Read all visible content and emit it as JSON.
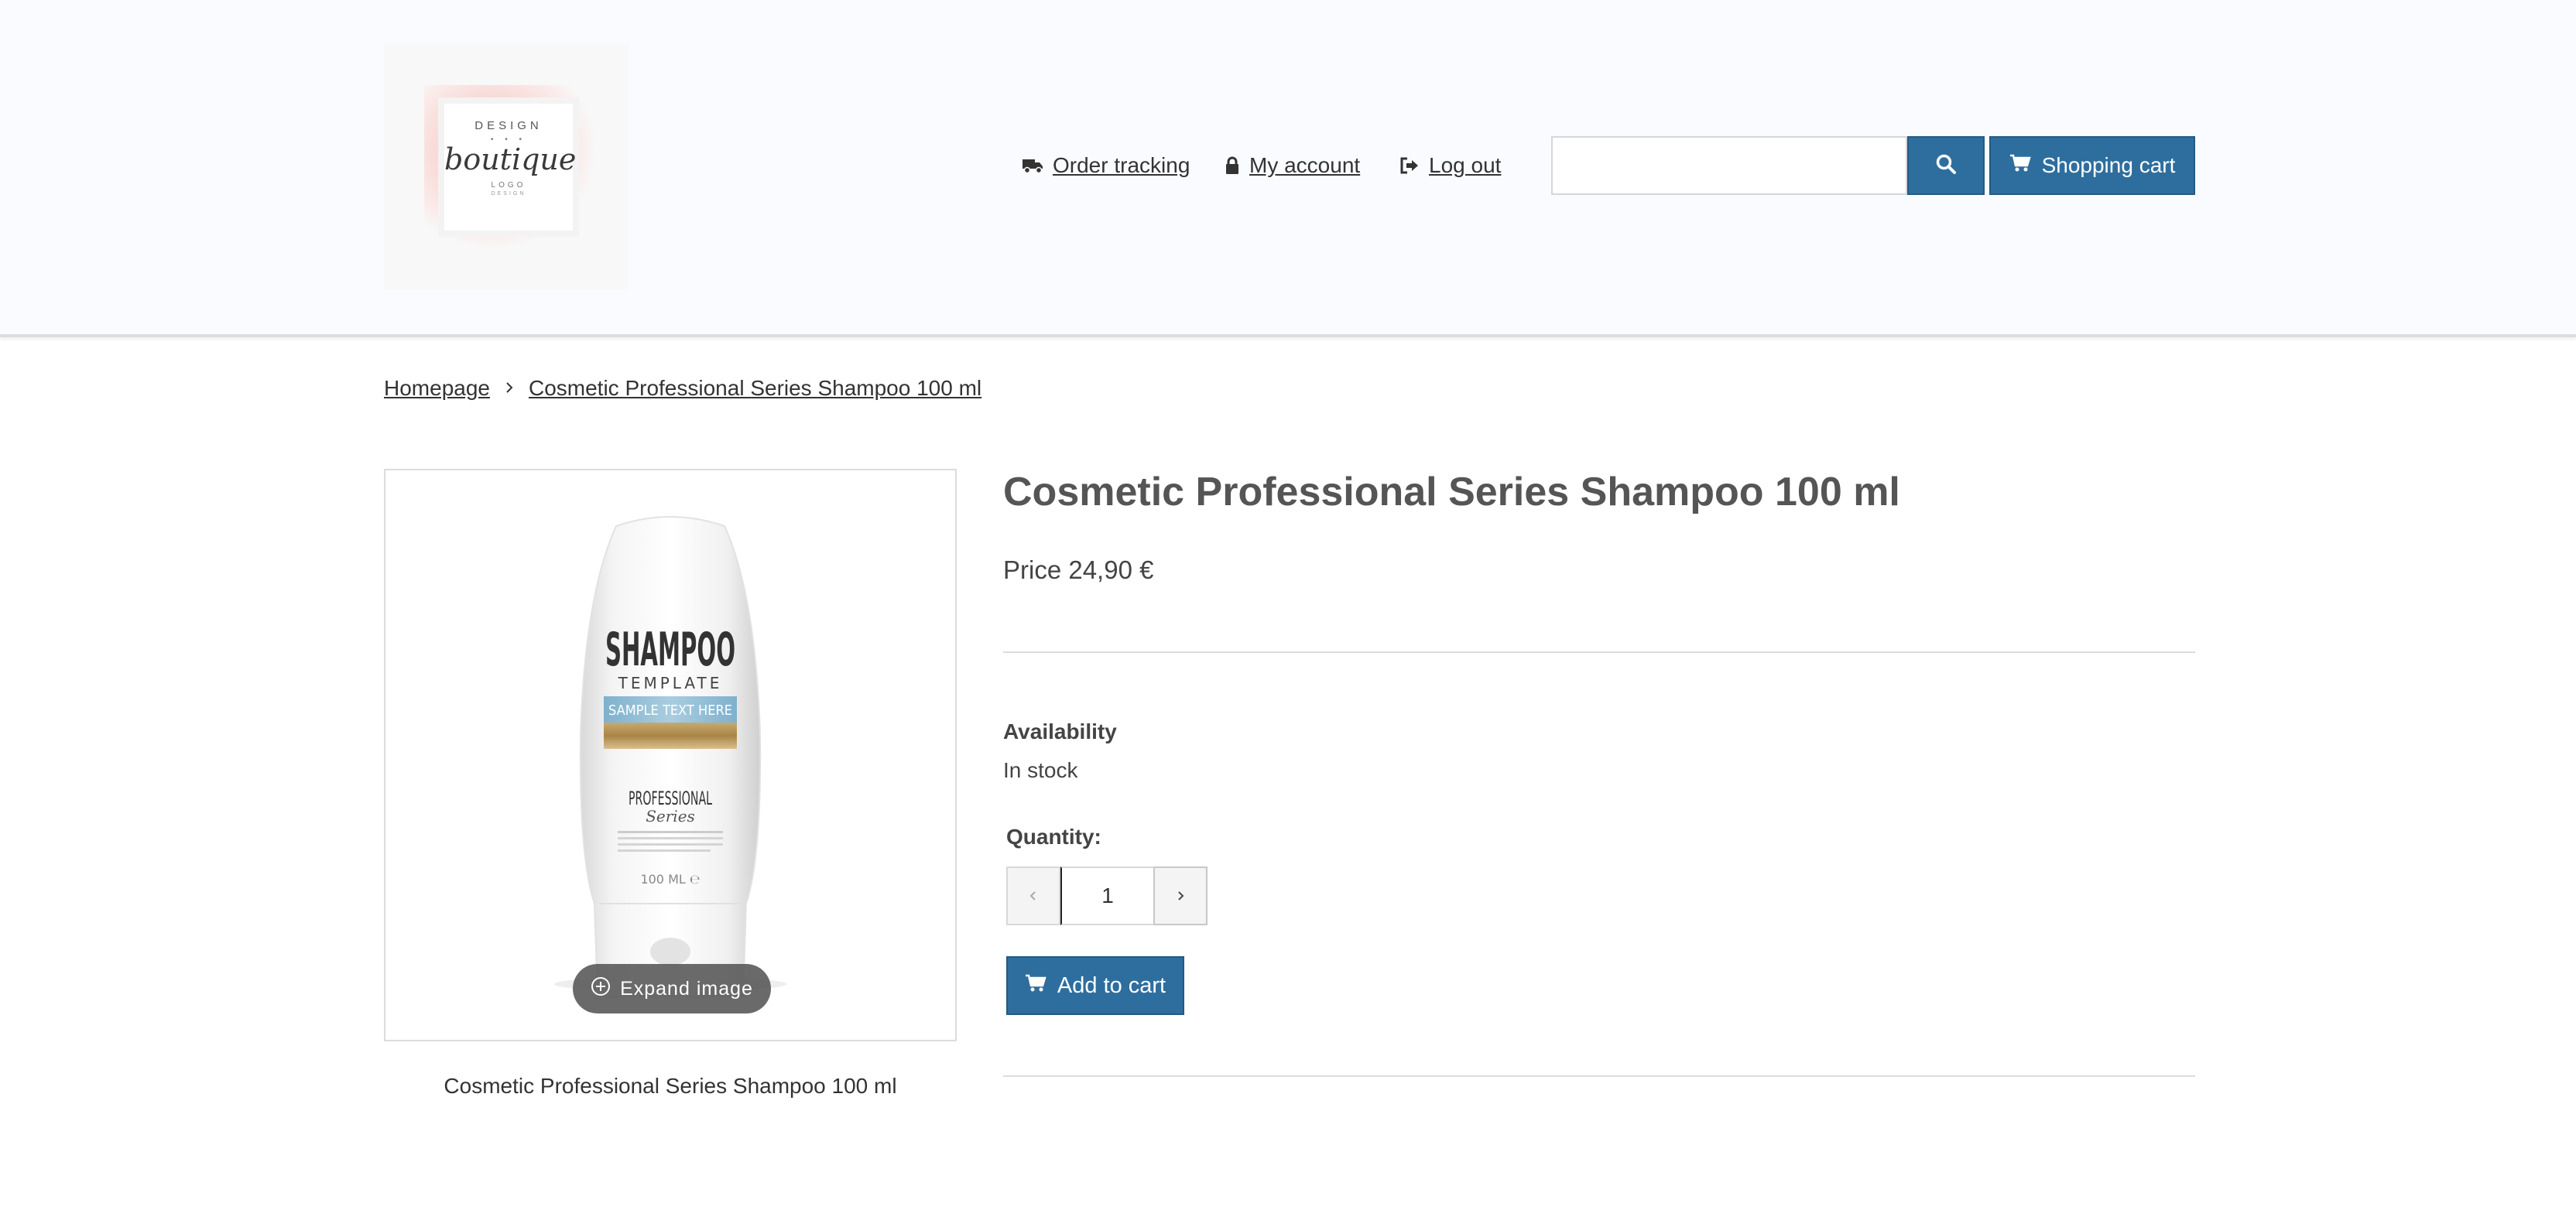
{
  "logo": {
    "line1": "DESIGN",
    "dots": "• • •",
    "script": "boutique",
    "line3": "LOGO",
    "line4": "DESIGN"
  },
  "nav": {
    "order_tracking": "Order tracking",
    "my_account": "My account",
    "log_out": "Log out"
  },
  "search": {
    "value": "",
    "placeholder": ""
  },
  "header": {
    "cart_label": "Shopping cart"
  },
  "breadcrumb": {
    "home": "Homepage",
    "current": "Cosmetic Professional Series Shampoo 100 ml"
  },
  "product": {
    "title": "Cosmetic Professional Series Shampoo 100 ml",
    "price": "Price 24,90 €",
    "availability_label": "Availability",
    "availability_value": "In stock",
    "quantity_label": "Quantity:",
    "quantity_value": "1",
    "add_to_cart_label": "Add to cart",
    "image_caption": "Cosmetic Professional Series Shampoo 100 ml",
    "expand_label": "Expand image",
    "bottle": {
      "brand": "SHAMPOO",
      "subtitle": "TEMPLATE",
      "band_text": "SAMPLE TEXT HERE",
      "series_top": "PROFESSIONAL",
      "series_script": "Series",
      "volume": "100 ML ℮"
    }
  },
  "colors": {
    "accent": "#2e6e9e",
    "header_bg": "#fafbfe",
    "text": "#333333"
  },
  "icons": {
    "order_tracking": "truck-icon",
    "my_account": "lock-icon",
    "log_out": "sign-out-icon",
    "search": "search-icon",
    "cart": "shopping-cart-icon",
    "breadcrumb_sep": "chevron-right-icon",
    "expand": "plus-circle-icon",
    "qty_dec": "chevron-left-icon",
    "qty_inc": "chevron-right-icon"
  }
}
